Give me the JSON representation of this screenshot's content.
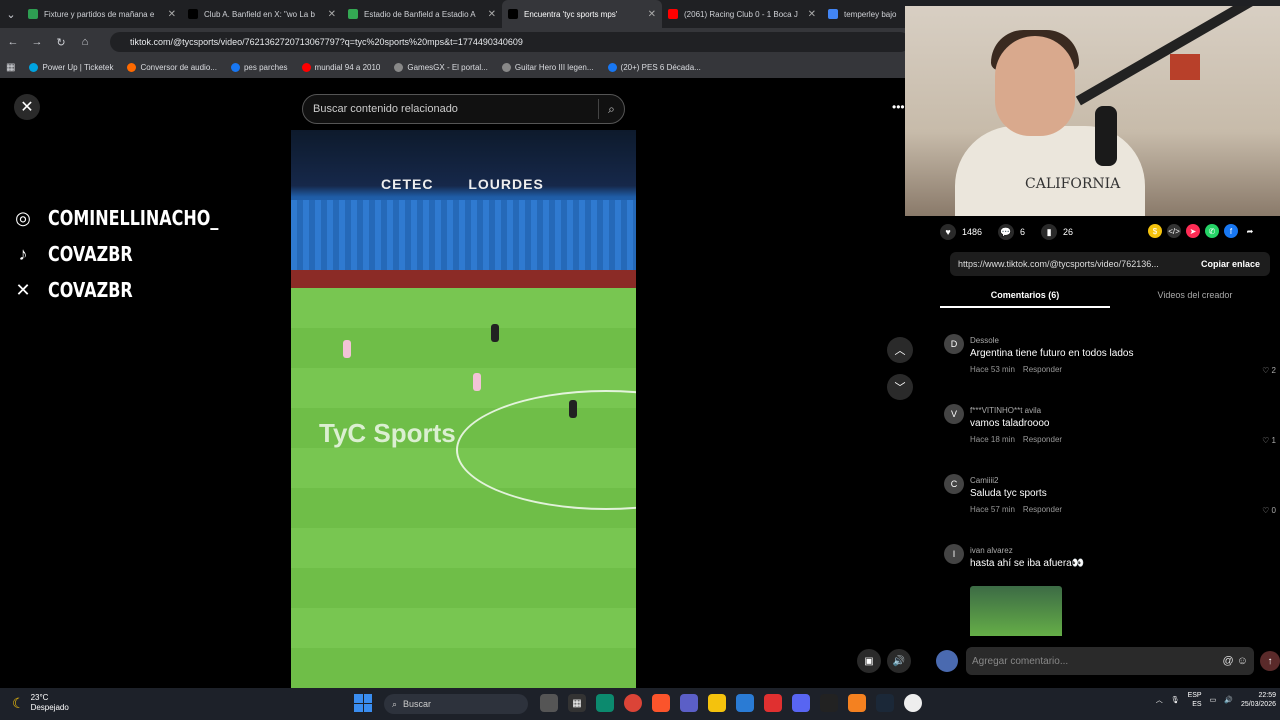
{
  "browser": {
    "tabs": [
      {
        "title": "Fixture y partidos de mañana e",
        "color": "#2e9e52"
      },
      {
        "title": "Club A. Banfield en X: \"wo La b",
        "color": "#000000"
      },
      {
        "title": "Estadio de Banfield a Estadio A",
        "color": "#34a853"
      },
      {
        "title": "Encuentra 'tyc sports mps'",
        "color": "#000000",
        "active": true
      },
      {
        "title": "(2061) Racing Club 0 - 1 Boca J",
        "color": "#ff0000"
      },
      {
        "title": "temperley bajo",
        "color": "#4285f4"
      }
    ],
    "url": "tiktok.com/@tycsports/video/7621362720713067797?q=tyc%20sports%20mps&t=1774490340609",
    "bookmarks": [
      {
        "label": "Power Up | Ticketek",
        "color": "#00a3e0"
      },
      {
        "label": "Conversor de audio...",
        "color": "#ff6a00"
      },
      {
        "label": "pes parches",
        "color": "#1877f2"
      },
      {
        "label": "mundial 94 a 2010",
        "color": "#ff0000"
      },
      {
        "label": "GamesGX - El portal...",
        "color": "#888888"
      },
      {
        "label": "Guitar Hero III legen...",
        "color": "#888888"
      },
      {
        "label": "(20+) PES 6 Década...",
        "color": "#1877f2"
      }
    ]
  },
  "tiktok": {
    "search_placeholder": "Buscar contenido relacionado",
    "video": {
      "sponsor_1": "CETEC",
      "sponsor_2": "LOURDES",
      "brand": "TyC Sports"
    },
    "actions": {
      "likes": "1486",
      "comments": "6",
      "saves": "26"
    },
    "link": "https://www.tiktok.com/@tycsports/video/762136...",
    "copy_label": "Copiar enlace",
    "tabs": [
      "Comentarios (6)",
      "Videos del creador"
    ],
    "comments": [
      {
        "user": "Dessole",
        "text": "Argentina tiene futuro en todos lados",
        "time": "Hace 53 min",
        "reply": "Responder",
        "likes": "2",
        "avatar": "D"
      },
      {
        "user": "f***VITINHO**t avila",
        "text": "vamos taladroooo",
        "time": "Hace 18 min",
        "reply": "Responder",
        "likes": "1",
        "avatar": "V"
      },
      {
        "user": "Camiiii2",
        "text": "Saluda tyc sports",
        "time": "Hace 57 min",
        "reply": "Responder",
        "likes": "0",
        "avatar": "C"
      },
      {
        "user": "ivan alvarez",
        "text": "hasta ahí se iba afuera👀",
        "time": "",
        "reply": "",
        "likes": "",
        "avatar": "I"
      }
    ],
    "composer_placeholder": "Agregar comentario..."
  },
  "overlay": {
    "social": [
      {
        "icon": "instagram-icon",
        "glyph": "◎",
        "handle": "COMINELLINACHO_"
      },
      {
        "icon": "tiktok-icon",
        "glyph": "♪",
        "handle": "COVAZBR"
      },
      {
        "icon": "x-icon",
        "glyph": "✕",
        "handle": "COVAZBR"
      }
    ],
    "webcam_shirt": "CALIFORNIA"
  },
  "taskbar": {
    "temp": "23°C",
    "weather": "Despejado",
    "search": "Buscar",
    "lang_1": "ESP",
    "lang_2": "ES",
    "time": "22:59",
    "date": "25/03/2026"
  }
}
